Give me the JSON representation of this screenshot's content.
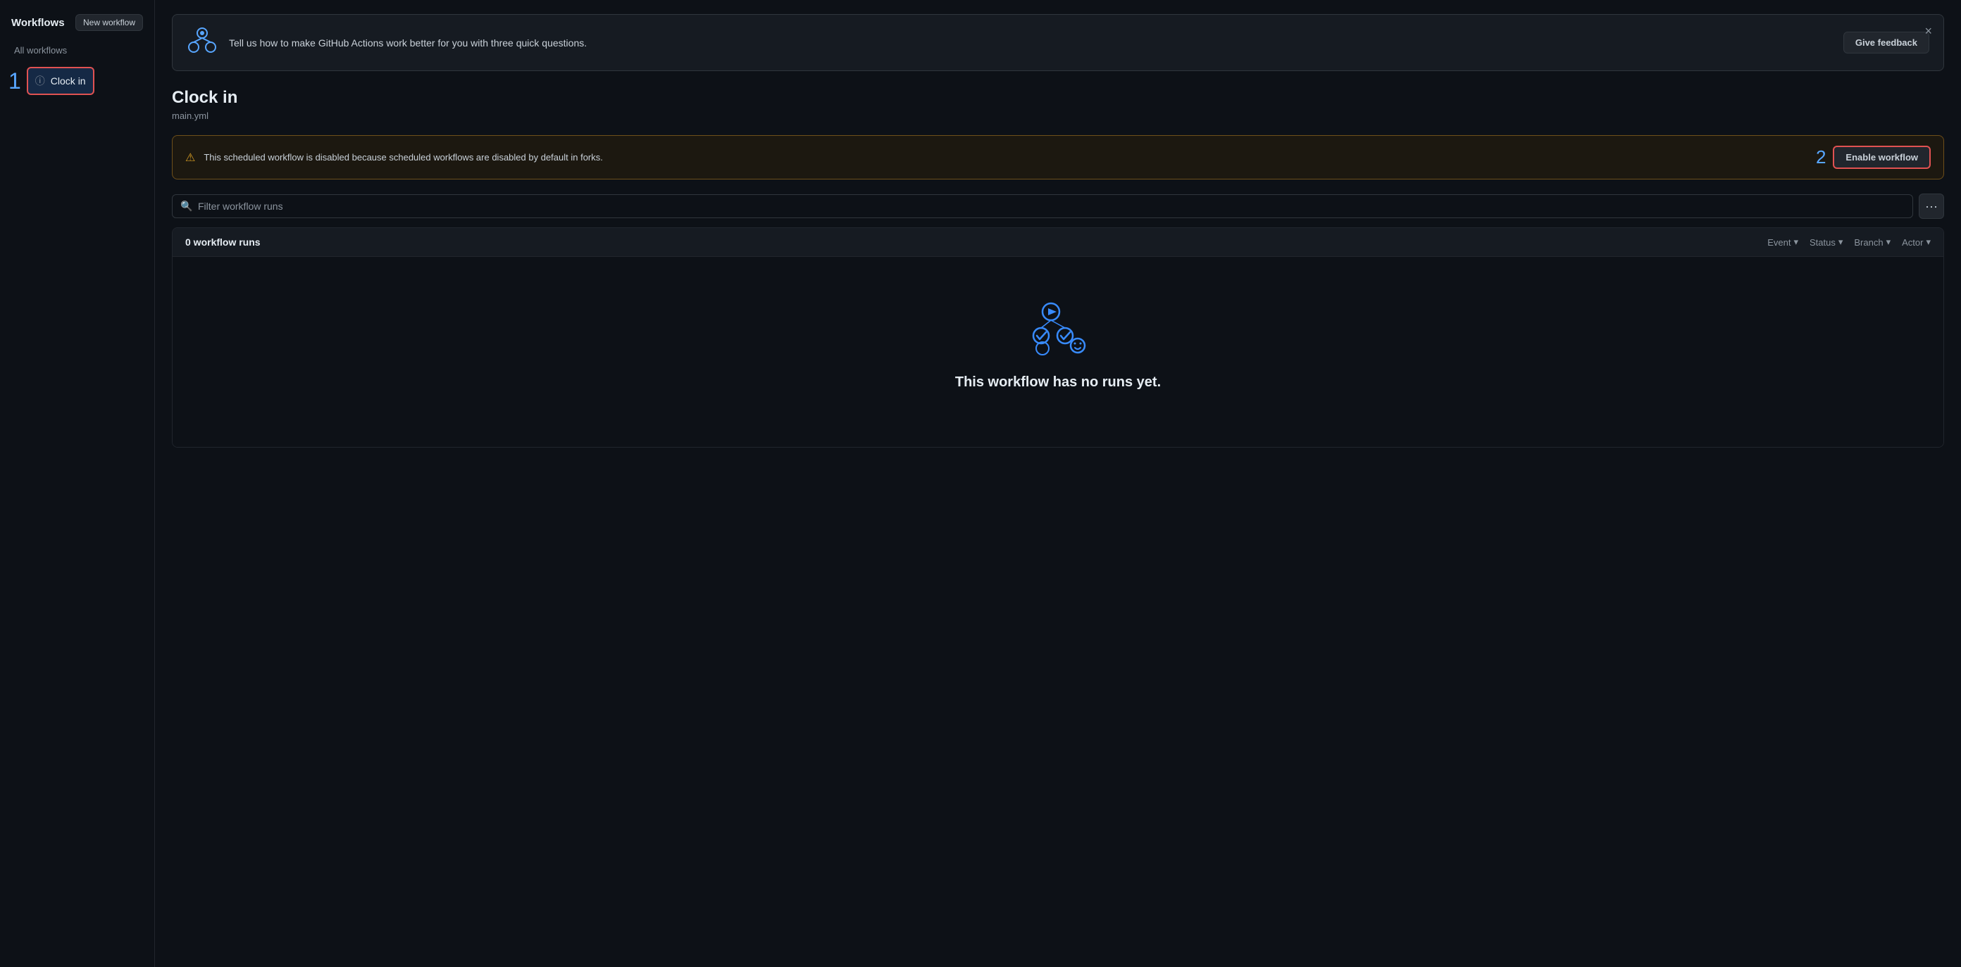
{
  "sidebar": {
    "title": "Workflows",
    "new_workflow_label": "New workflow",
    "all_workflows_label": "All workflows",
    "items": [
      {
        "number": "1",
        "icon": "ⓘ",
        "label": "Clock in",
        "active": true
      }
    ]
  },
  "feedback_banner": {
    "text": "Tell us how to make GitHub Actions work better for you with three quick questions.",
    "button_label": "Give feedback",
    "close_label": "×"
  },
  "workflow": {
    "title": "Clock in",
    "subtitle": "main.yml"
  },
  "warning": {
    "text": "This scheduled workflow is disabled because scheduled workflows are disabled by default in forks.",
    "step_number": "2",
    "enable_label": "Enable workflow"
  },
  "filter": {
    "placeholder": "Filter workflow runs",
    "more_label": "···"
  },
  "runs_table": {
    "header": {
      "count_label": "0 workflow runs",
      "filters": [
        {
          "label": "Event",
          "icon": "▾"
        },
        {
          "label": "Status",
          "icon": "▾"
        },
        {
          "label": "Branch",
          "icon": "▾"
        },
        {
          "label": "Actor",
          "icon": "▾"
        }
      ]
    },
    "empty_state": {
      "title": "This workflow has no runs yet."
    }
  }
}
